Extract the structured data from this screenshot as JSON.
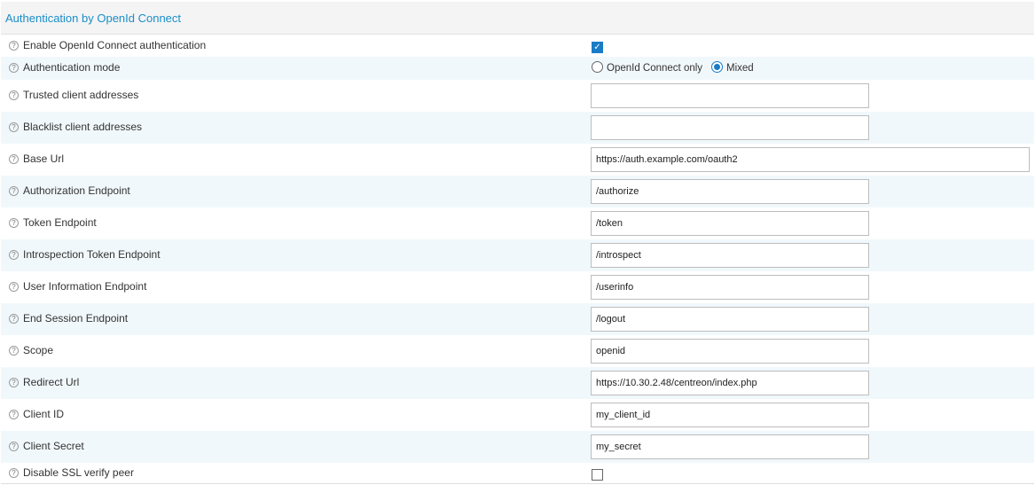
{
  "section": {
    "title": "Authentication by OpenId Connect"
  },
  "help_glyph": "?",
  "rows": {
    "enable": {
      "label": "Enable OpenId Connect authentication",
      "checked": true
    },
    "mode": {
      "label": "Authentication mode",
      "options": [
        "OpenId Connect only",
        "Mixed"
      ],
      "selected": "Mixed"
    },
    "trusted": {
      "label": "Trusted client addresses",
      "value": ""
    },
    "blacklist": {
      "label": "Blacklist client addresses",
      "value": ""
    },
    "base_url": {
      "label": "Base Url",
      "value": "https://auth.example.com/oauth2"
    },
    "authz": {
      "label": "Authorization Endpoint",
      "value": "/authorize"
    },
    "token": {
      "label": "Token Endpoint",
      "value": "/token"
    },
    "introspect": {
      "label": "Introspection Token Endpoint",
      "value": "/introspect"
    },
    "userinfo": {
      "label": "User Information Endpoint",
      "value": "/userinfo"
    },
    "end_session": {
      "label": "End Session Endpoint",
      "value": "/logout"
    },
    "scope": {
      "label": "Scope",
      "value": "openid"
    },
    "redirect": {
      "label": "Redirect Url",
      "value": "https://10.30.2.48/centreon/index.php"
    },
    "client_id": {
      "label": "Client ID",
      "value": "my_client_id"
    },
    "client_secret": {
      "label": "Client Secret",
      "value": "my_secret"
    },
    "ssl_verify": {
      "label": "Disable SSL verify peer",
      "checked": false
    }
  },
  "colors": {
    "accent": "#1a8ec8",
    "checkbox": "#1a7bc7",
    "row_alt": "#f1f8fb"
  }
}
